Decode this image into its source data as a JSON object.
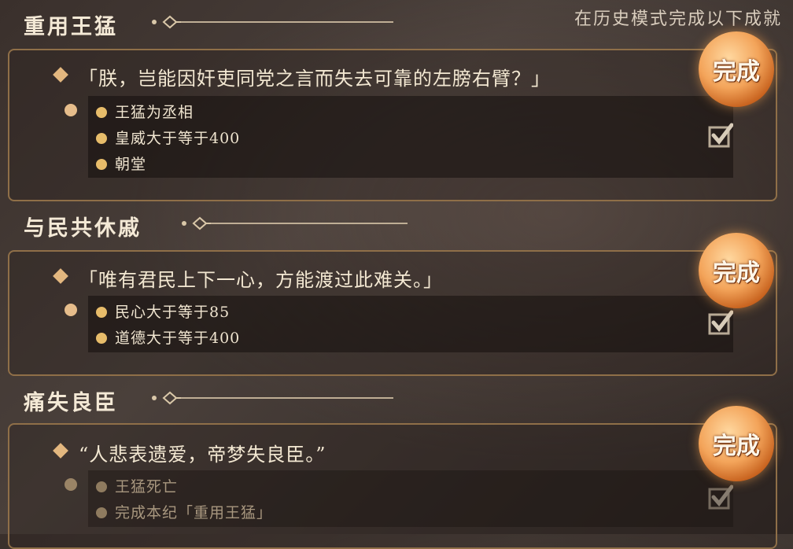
{
  "header": {
    "note": "在历史模式完成以下成就"
  },
  "achievements": [
    {
      "title": "重用王猛",
      "quote": "「朕，岂能因奸吏同党之言而失去可靠的左膀右臂？」",
      "conditions": [
        "王猛为丞相",
        "皇威大于等于400",
        "朝堂"
      ],
      "status": "完成",
      "completed": true
    },
    {
      "title": "与民共休戚",
      "quote": "「唯有君民上下一心，方能渡过此难关。」",
      "conditions": [
        "民心大于等于85",
        "道德大于等于400"
      ],
      "status": "完成",
      "completed": true
    },
    {
      "title": "痛失良臣",
      "quote": "“人悲表遗爱，帝梦失良臣。”",
      "conditions": [
        "王猛死亡",
        "完成本纪「重用王猛」"
      ],
      "status": "完成",
      "completed": true
    }
  ],
  "colors": {
    "accent": "#e7bc6a",
    "border": "#8f6f48",
    "stamp": "#f3a45a"
  }
}
